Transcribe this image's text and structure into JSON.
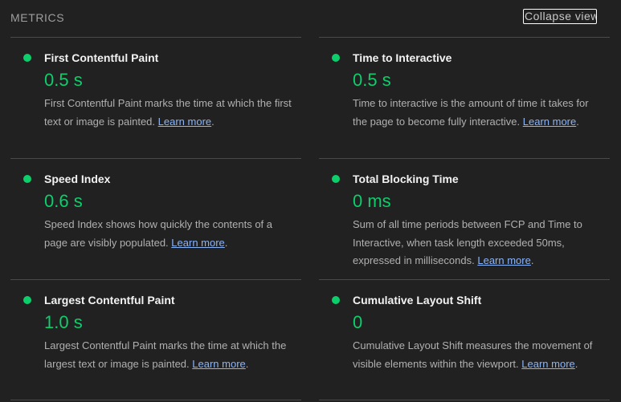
{
  "header": {
    "title": "Metrics",
    "collapse_label": "Collapse view"
  },
  "colors": {
    "background": "#212121",
    "pass_green": "#0cce6b",
    "link": "#8ab4f8",
    "divider": "#4a4a4a"
  },
  "metrics": [
    {
      "title": "First Contentful Paint",
      "value": "0.5 s",
      "status": "pass",
      "description": "First Contentful Paint marks the time at which the first text or image is painted.",
      "link_text": "Learn more",
      "trailing": "."
    },
    {
      "title": "Time to Interactive",
      "value": "0.5 s",
      "status": "pass",
      "description": "Time to interactive is the amount of time it takes for the page to become fully interactive.",
      "link_text": "Learn more",
      "trailing": "."
    },
    {
      "title": "Speed Index",
      "value": "0.6 s",
      "status": "pass",
      "description": "Speed Index shows how quickly the contents of a page are visibly populated.",
      "link_text": "Learn more",
      "trailing": "."
    },
    {
      "title": "Total Blocking Time",
      "value": "0 ms",
      "status": "pass",
      "description": "Sum of all time periods between FCP and Time to Interactive, when task length exceeded 50ms, expressed in milliseconds.",
      "link_text": "Learn more",
      "trailing": "."
    },
    {
      "title": "Largest Contentful Paint",
      "value": "1.0 s",
      "status": "pass",
      "description": "Largest Contentful Paint marks the time at which the largest text or image is painted.",
      "link_text": "Learn more",
      "trailing": "."
    },
    {
      "title": "Cumulative Layout Shift",
      "value": "0",
      "status": "pass",
      "description": "Cumulative Layout Shift measures the movement of visible elements within the viewport.",
      "link_text": "Learn more",
      "trailing": "."
    }
  ]
}
